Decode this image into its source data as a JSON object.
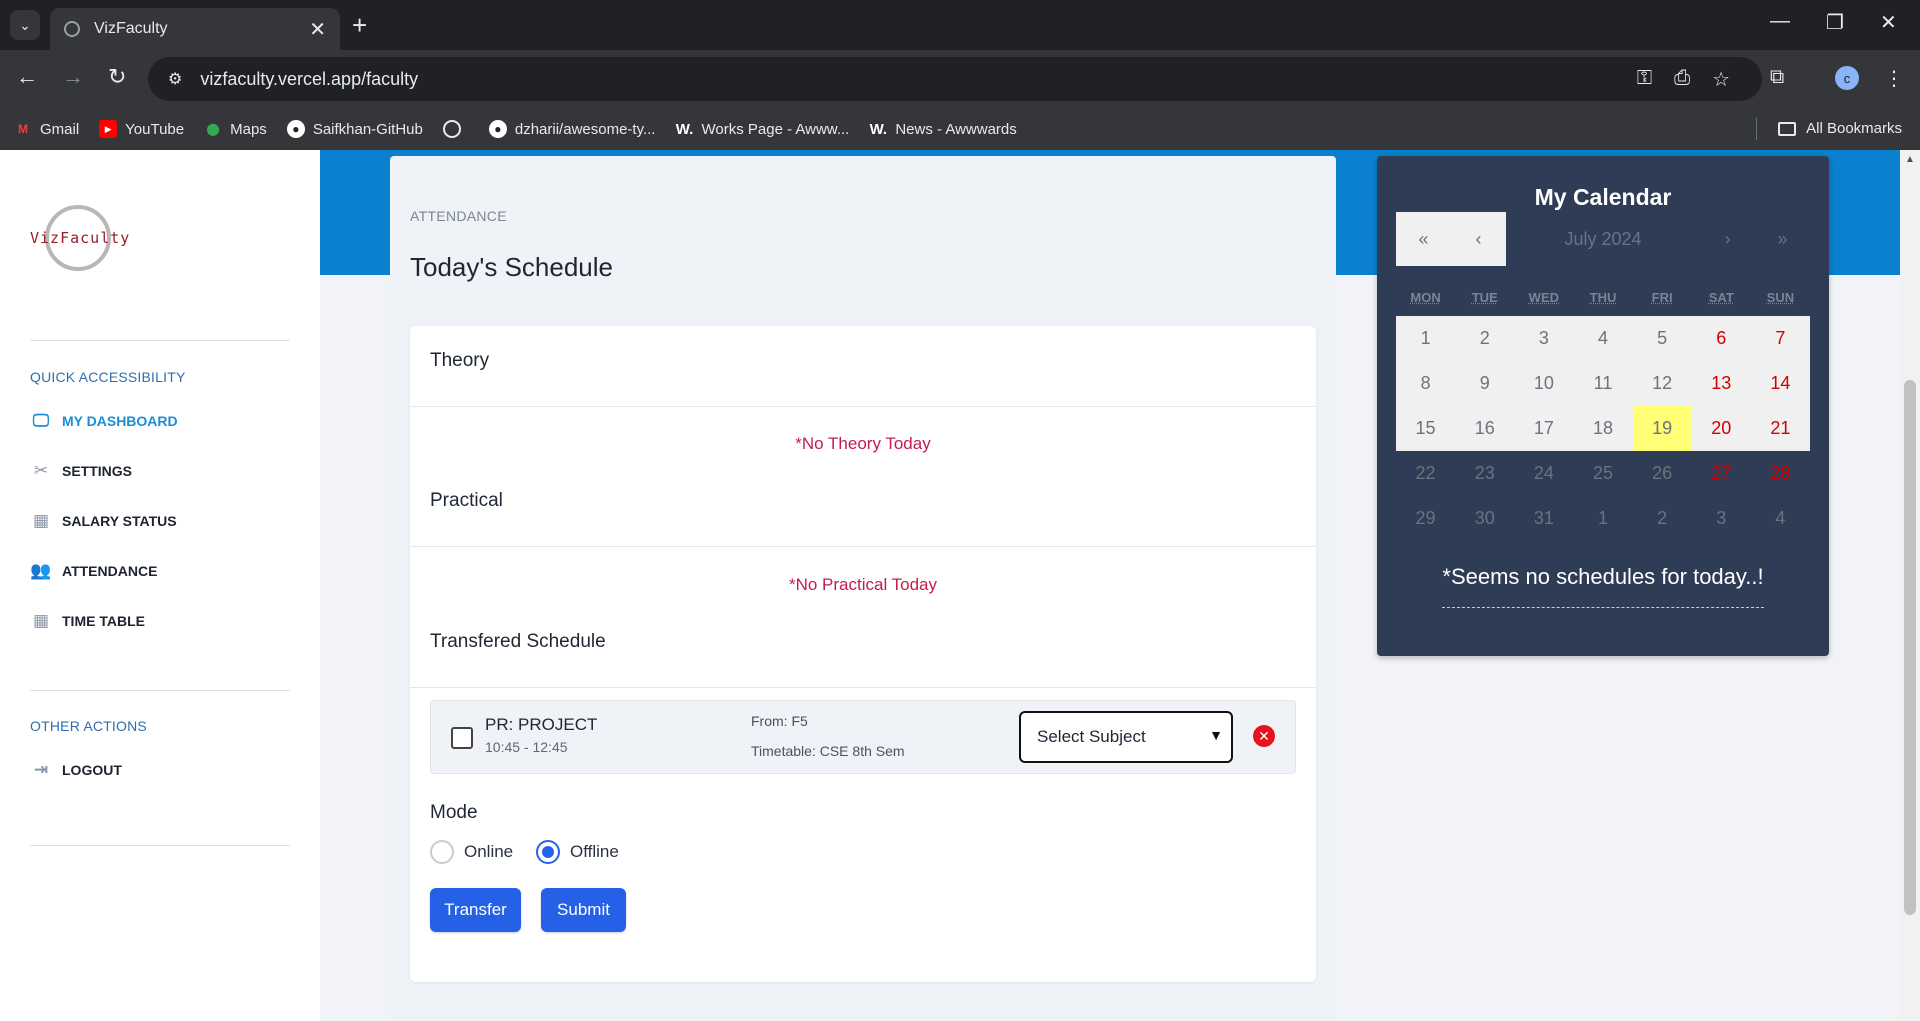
{
  "browser": {
    "tab_title": "VizFaculty",
    "url": "vizfaculty.vercel.app/faculty",
    "profile_initial": "c",
    "bookmarks": [
      {
        "label": "Gmail",
        "icon": "gmail-icon"
      },
      {
        "label": "YouTube",
        "icon": "youtube-icon"
      },
      {
        "label": "Maps",
        "icon": "maps-icon"
      },
      {
        "label": "Saifkhan-GitHub",
        "icon": "github-icon"
      },
      {
        "label": "",
        "icon": "globe-icon"
      },
      {
        "label": "dzharii/awesome-ty...",
        "icon": "github-icon"
      },
      {
        "label": "Works Page - Awww...",
        "icon": "awwwards-icon"
      },
      {
        "label": "News - Awwwards",
        "icon": "awwwards-icon"
      }
    ],
    "all_bookmarks": "All Bookmarks"
  },
  "sidebar": {
    "logo_text": "VizFaculty",
    "section_quick": "QUICK ACCESSIBILITY",
    "items": [
      {
        "label": "MY DASHBOARD",
        "icon": "monitor-icon"
      },
      {
        "label": "SETTINGS",
        "icon": "tools-icon"
      },
      {
        "label": "SALARY STATUS",
        "icon": "table-icon"
      },
      {
        "label": "ATTENDANCE",
        "icon": "people-icon"
      },
      {
        "label": "TIME TABLE",
        "icon": "table-icon"
      }
    ],
    "section_other": "OTHER ACTIONS",
    "logout": "LOGOUT"
  },
  "main": {
    "breadcrumb": "ATTENDANCE",
    "title": "Today's Schedule",
    "theory_head": "Theory",
    "theory_msg": "*No Theory Today",
    "practical_head": "Practical",
    "practical_msg": "*No Practical Today",
    "transfer_head": "Transfered Schedule",
    "transfer_item": {
      "name": "PR: PROJECT",
      "time": "10:45 - 12:45",
      "from": "From: F5",
      "timetable": "Timetable: CSE 8th Sem",
      "select_value": "Select Subject"
    },
    "mode_label": "Mode",
    "mode_online": "Online",
    "mode_offline": "Offline",
    "mode_selected": "Offline",
    "transfer_btn": "Transfer",
    "submit_btn": "Submit"
  },
  "calendar": {
    "title": "My Calendar",
    "nav_first": "«",
    "nav_prev": "‹",
    "month": "July 2024",
    "nav_next": "›",
    "nav_last": "»",
    "dow": [
      "MON",
      "TUE",
      "WED",
      "THU",
      "FRI",
      "SAT",
      "SUN"
    ],
    "days": [
      "1",
      "2",
      "3",
      "4",
      "5",
      "6",
      "7",
      "8",
      "9",
      "10",
      "11",
      "12",
      "13",
      "14",
      "15",
      "16",
      "17",
      "18",
      "19",
      "20",
      "21",
      "22",
      "23",
      "24",
      "25",
      "26",
      "27",
      "28",
      "29",
      "30",
      "31",
      "1",
      "2",
      "3",
      "4"
    ],
    "today": "19",
    "message": "*Seems no schedules for today..!"
  },
  "colors": {
    "accent_blue": "#0a80ce",
    "button_blue": "#2461e6",
    "alert_red": "#c41d4c",
    "calendar_bg": "#2f3c55",
    "today_highlight": "#ffff76"
  }
}
